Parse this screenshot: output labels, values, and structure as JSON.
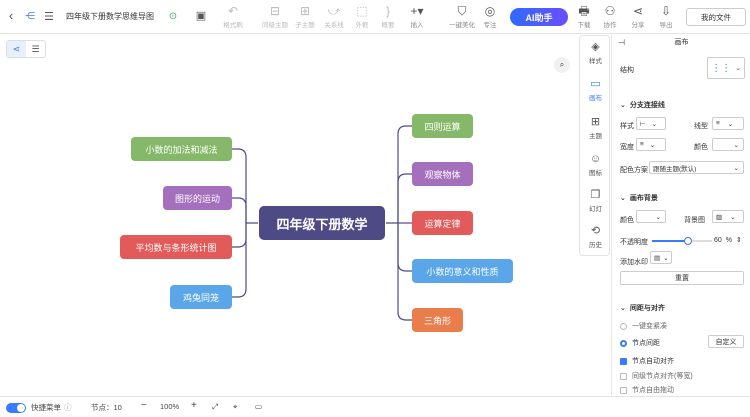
{
  "header": {
    "title": "四年级下册数学思维导图",
    "tools": [
      {
        "label": "格式刷",
        "icon": "format-brush-icon"
      },
      {
        "label": "同级主题",
        "icon": "sibling-topic-icon"
      },
      {
        "label": "子主题",
        "icon": "child-topic-icon"
      },
      {
        "label": "关系线",
        "icon": "relation-line-icon"
      },
      {
        "label": "外框",
        "icon": "boundary-icon"
      },
      {
        "label": "概要",
        "icon": "summary-icon"
      },
      {
        "label": "插入",
        "icon": "insert-icon"
      },
      {
        "label": "一键美化",
        "icon": "beautify-icon"
      },
      {
        "label": "专注",
        "icon": "focus-icon"
      },
      {
        "label": "下载",
        "icon": "download-icon"
      },
      {
        "label": "协作",
        "icon": "collaborate-icon"
      },
      {
        "label": "分享",
        "icon": "share-icon"
      },
      {
        "label": "导出",
        "icon": "export-icon"
      }
    ],
    "ai_label": "AI助手",
    "myfile_label": "我的文件"
  },
  "mindmap": {
    "root": "四年级下册数学",
    "left": [
      "小数的加法和减法",
      "图形的运动",
      "平均数与条形统计图",
      "鸡兔同笼"
    ],
    "right": [
      "四则运算",
      "观察物体",
      "运算定律",
      "小数的意义和性质",
      "三角形"
    ],
    "colors": {
      "root": "#4e4a86",
      "green": "#86b86a",
      "purple": "#a46fbd",
      "red": "#e35a5a",
      "blue": "#5aa6e8",
      "orange": "#ea7d4c",
      "line": "#4e4a86"
    }
  },
  "sidetabs": [
    "样式",
    "画布",
    "主题",
    "图标",
    "幻灯",
    "历史"
  ],
  "panel": {
    "title": "画布",
    "structure_label": "结构",
    "branch_section": "分支连接线",
    "style_label": "样式",
    "linetype_label": "线型",
    "width_label": "宽度",
    "color_label": "颜色",
    "scheme_label": "配色方案",
    "scheme_value": "跟随主题(默认)",
    "bg_section": "画布背景",
    "bg_color_label": "颜色",
    "bg_image_label": "背景图",
    "opacity_label": "不透明度",
    "opacity_value": "60",
    "opacity_unit": "%",
    "opacity_fraction": 0.6,
    "watermark_label": "添加水印",
    "reset_label": "重置",
    "spacing_section": "间距与对齐",
    "compact_label": "一键变紧凑",
    "node_spacing_label": "节点间距",
    "custom_label": "自定义",
    "auto_align_label": "节点自动对齐",
    "same_level_label": "同级节点对齐(等宽)",
    "free_drag_label": "节点自由拖动"
  },
  "status": {
    "shortcut_label": "快捷菜单",
    "nodes_label": "节点：",
    "nodes_count": "10",
    "zoom": "100%"
  }
}
